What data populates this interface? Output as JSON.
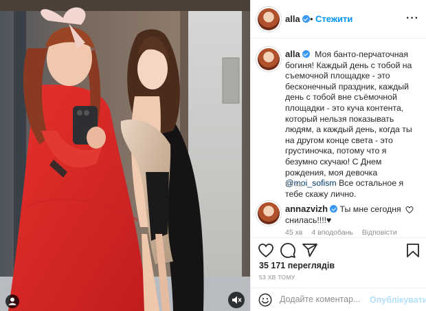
{
  "post": {
    "username": "alla",
    "verified": true,
    "follow_label": "Стежити",
    "separator": "•",
    "more_label": "···"
  },
  "caption": {
    "username": "alla",
    "text_before_mention": "Моя банто-перчаточная богиня! Каждый день с тобой на съемочной площадке - это бесконечный праздник, каждый день с тобой вне съёмочной площадки - это куча контента, который нельзя показывать людям, а каждый день, когда ты на другом конце света - это грустиночка, потому что я безумно скучаю! С Днем рождения, моя девочка",
    "mention": "@moi_sofism",
    "text_after_mention": " Все остальное я тебе скажу лично.",
    "time": "53 хв"
  },
  "comment": {
    "username": "annazvizh",
    "verified": true,
    "text": "Ты мне сегодня снилась!!!!♥",
    "time": "45 хв",
    "likes": "4 вподобань",
    "reply_label": "Відповісти"
  },
  "actions": {
    "like": "heart-icon",
    "comment": "comment-icon",
    "share": "share-icon",
    "save": "bookmark-icon"
  },
  "stats": {
    "views": "35 171 переглядів",
    "posted": "53 ХВ ТОМУ"
  },
  "add_comment": {
    "placeholder": "Додайте коментар...",
    "post_label": "Опублікувати"
  },
  "colors": {
    "accent": "#0095f6",
    "post_disabled": "#b2dffc",
    "verified": "#3897f0",
    "muted_text": "#8e8e8e"
  }
}
